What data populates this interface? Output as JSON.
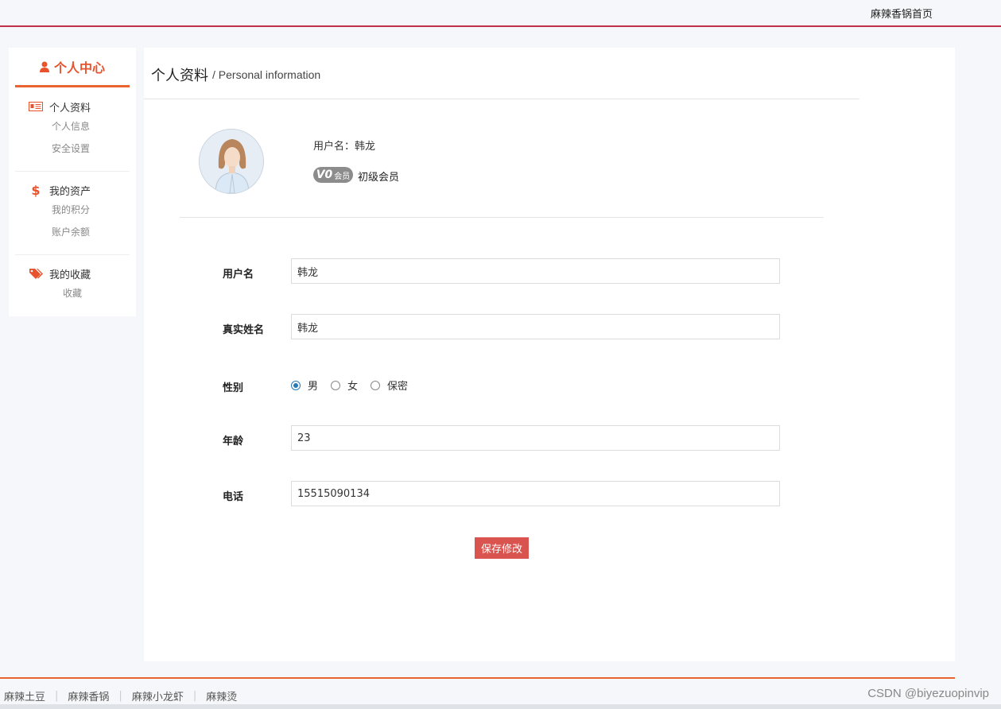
{
  "topbar": {
    "home_link": "麻辣香锅首页"
  },
  "sidebar": {
    "title": "个人中心",
    "groups": [
      {
        "label": "个人资料",
        "items": [
          "个人信息",
          "安全设置"
        ]
      },
      {
        "label": "我的资产",
        "items": [
          "我的积分",
          "账户余额"
        ]
      },
      {
        "label": "我的收藏",
        "items": [
          "收藏"
        ]
      }
    ]
  },
  "main": {
    "title_zh": "个人资料",
    "title_en": "/ Personal information",
    "profile": {
      "username_label": "用户名：韩龙",
      "badge_level": "V0",
      "badge_text": "会员",
      "level_name": "初级会员"
    },
    "form": {
      "username": {
        "label": "用户名",
        "value": "韩龙"
      },
      "realname": {
        "label": "真实姓名",
        "value": "韩龙"
      },
      "gender": {
        "label": "性别",
        "options": [
          "男",
          "女",
          "保密"
        ],
        "selected": "男"
      },
      "age": {
        "label": "年龄",
        "value": "23"
      },
      "phone": {
        "label": "电话",
        "value": "15515090134"
      }
    },
    "save_label": "保存修改"
  },
  "footer": {
    "links": [
      "麻辣土豆",
      "麻辣香锅",
      "麻辣小龙虾",
      "麻辣烫"
    ],
    "watermark": "CSDN @biyezuopinvip"
  },
  "colors": {
    "accent": "#e8532e",
    "topbar_border": "#c0304a",
    "save_button": "#d9534f",
    "radio_checked": "#2a7ab8"
  }
}
